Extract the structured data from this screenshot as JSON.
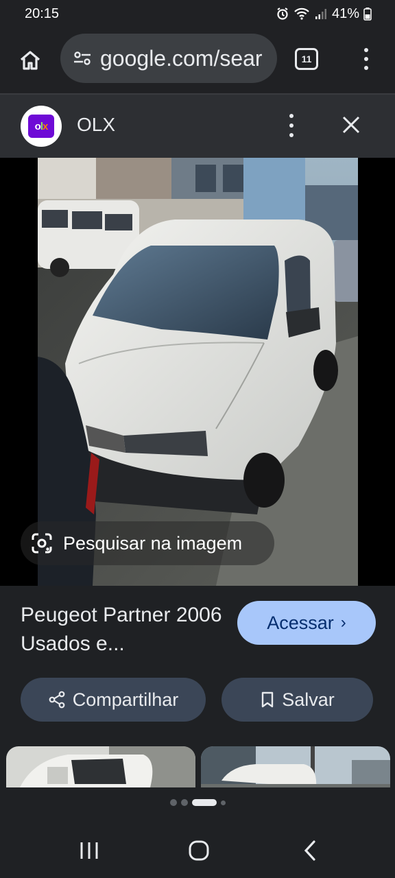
{
  "status": {
    "time": "20:15",
    "battery": "41%"
  },
  "browser": {
    "url": "google.com/sear",
    "tab_count": "11"
  },
  "site": {
    "name": "OLX",
    "logo_text_o": "o",
    "logo_text_l": "l",
    "logo_text_x": "x"
  },
  "viewer": {
    "lens_label": "Pesquisar na imagem"
  },
  "result": {
    "title": "Peugeot Partner 2006 Usados e...",
    "visit_label": "Acessar",
    "visit_chevron": "›"
  },
  "actions": {
    "share_label": "Compartilhar",
    "save_label": "Salvar"
  },
  "colors": {
    "accent": "#a8c7fa",
    "chip": "#3b4657",
    "olx_purple": "#6e0ad6"
  },
  "icons": [
    "home-icon",
    "site-info-icon",
    "tabs-icon",
    "more-vert-icon",
    "close-icon",
    "lens-icon",
    "share-icon",
    "bookmark-icon",
    "recents-icon",
    "home-nav-icon",
    "back-icon"
  ]
}
